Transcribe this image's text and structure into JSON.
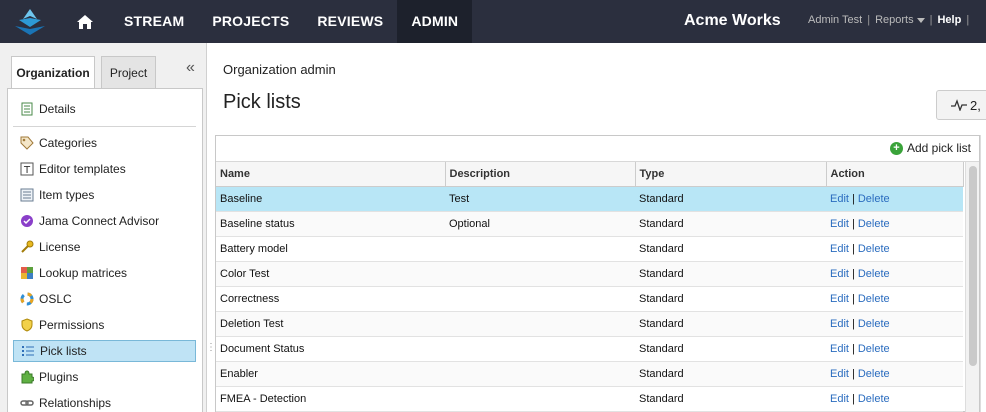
{
  "nav": {
    "items": [
      "STREAM",
      "PROJECTS",
      "REVIEWS",
      "ADMIN"
    ],
    "org": "Acme Works",
    "user": "Admin Test",
    "reports": "Reports",
    "help": "Help"
  },
  "sidebar": {
    "tabs": [
      "Organization",
      "Project"
    ],
    "items": [
      {
        "label": "Details",
        "icon": "details-icon"
      },
      {
        "label": "Categories",
        "icon": "tag-icon"
      },
      {
        "label": "Editor templates",
        "icon": "editor-template-icon"
      },
      {
        "label": "Item types",
        "icon": "item-types-icon"
      },
      {
        "label": "Jama Connect Advisor",
        "icon": "advisor-icon"
      },
      {
        "label": "License",
        "icon": "key-icon"
      },
      {
        "label": "Lookup matrices",
        "icon": "matrix-icon"
      },
      {
        "label": "OSLC",
        "icon": "oslc-icon"
      },
      {
        "label": "Permissions",
        "icon": "shield-icon"
      },
      {
        "label": "Pick lists",
        "icon": "list-icon"
      },
      {
        "label": "Plugins",
        "icon": "puzzle-icon"
      },
      {
        "label": "Relationships",
        "icon": "link-icon"
      }
    ],
    "selected": "Pick lists"
  },
  "main": {
    "breadcrumb": "Organization admin",
    "title": "Pick lists",
    "activity": "2,",
    "add_label": "Add pick list",
    "columns": [
      "Name",
      "Description",
      "Type",
      "Action"
    ],
    "rows": [
      {
        "name": "Baseline",
        "description": "Test",
        "type": "Standard"
      },
      {
        "name": "Baseline status",
        "description": "Optional",
        "type": "Standard"
      },
      {
        "name": "Battery model",
        "description": "",
        "type": "Standard"
      },
      {
        "name": "Color Test",
        "description": "",
        "type": "Standard"
      },
      {
        "name": "Correctness",
        "description": "",
        "type": "Standard"
      },
      {
        "name": "Deletion Test",
        "description": "",
        "type": "Standard"
      },
      {
        "name": "Document Status",
        "description": "",
        "type": "Standard"
      },
      {
        "name": "Enabler",
        "description": "",
        "type": "Standard"
      },
      {
        "name": "FMEA - Detection",
        "description": "",
        "type": "Standard"
      }
    ],
    "edit_label": "Edit",
    "delete_label": "Delete",
    "link_sep": "|"
  },
  "colors": {
    "topbar": "#2b2f3e",
    "selected_row": "#b8e6f6",
    "link": "#2a6cbf"
  }
}
